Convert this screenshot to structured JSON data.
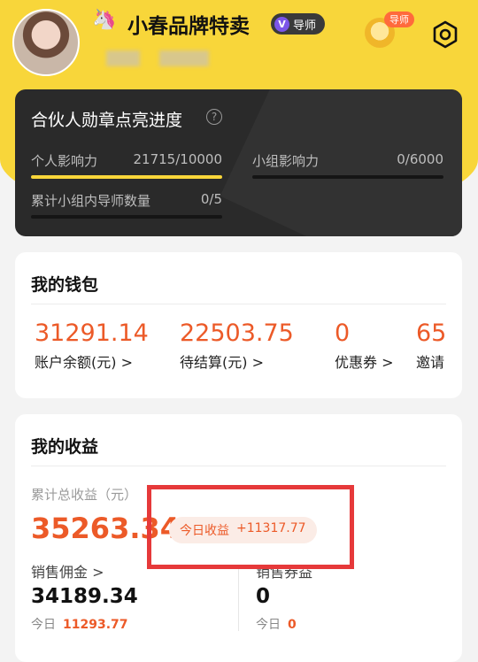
{
  "header": {
    "username": "小春品牌特卖",
    "emoji": "🦄",
    "tutor_badge": "导师",
    "medal_tag": "导师",
    "icons": {
      "settings": "gear-icon",
      "badge": "medal-icon",
      "verified": "v-badge-icon"
    }
  },
  "progress": {
    "title": "合伙人勋章点亮进度",
    "metrics": [
      {
        "label": "个人影响力",
        "value": "21715/10000",
        "fraction": 1.0
      },
      {
        "label": "小组影响力",
        "value": "0/6000",
        "fraction": 0
      },
      {
        "label": "累计小组内导师数量",
        "value": "0/5",
        "fraction": 0
      }
    ]
  },
  "wallet": {
    "title": "我的钱包",
    "items": [
      {
        "amount": "31291.14",
        "label": "账户余额(元)",
        "arrow": ">"
      },
      {
        "amount": "22503.75",
        "label": "待结算(元)",
        "arrow": ">"
      },
      {
        "amount": "0",
        "label": "优惠券",
        "arrow": ">"
      },
      {
        "amount": "65",
        "label": "邀请",
        "arrow": ""
      }
    ]
  },
  "earnings": {
    "title": "我的收益",
    "total_label": "累计总收益（元）",
    "total_amount": "35263.34",
    "today_label": "今日收益",
    "today_amount": "+11317.77",
    "sales": {
      "label": "销售佣金",
      "arrow": ">",
      "amount": "34189.34",
      "today_label": "今日",
      "today_amount": "11293.77"
    },
    "other": {
      "label": "销售券益",
      "amount": "0",
      "today_label": "今日",
      "today_amount": "0"
    }
  },
  "colors": {
    "accent": "#ec5a28",
    "brand_yellow": "#f8d63a",
    "highlight_box": "#e6393a"
  }
}
